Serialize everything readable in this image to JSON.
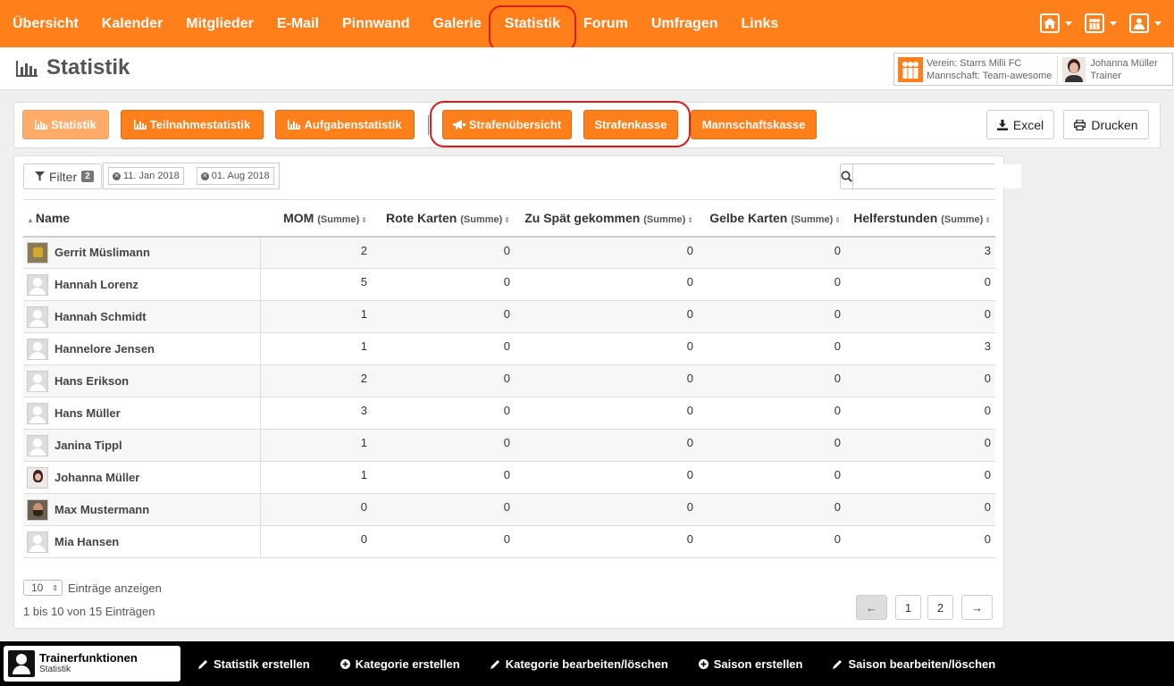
{
  "nav": {
    "items": [
      "Übersicht",
      "Kalender",
      "Mitglieder",
      "E-Mail",
      "Pinnwand",
      "Galerie",
      "Statistik",
      "Forum",
      "Umfragen",
      "Links"
    ],
    "active": "Statistik",
    "right_icons": [
      "home-icon",
      "team-icon",
      "user-icon"
    ]
  },
  "header": {
    "title": "Statistik",
    "club": "Verein: Starrs Milli FC",
    "team": "Mannschaft: Team-awesome",
    "user_name": "Johanna Müller",
    "user_role": "Trainer"
  },
  "toolbar": {
    "statistik": "Statistik",
    "teilnahme": "Teilnahmestatistik",
    "aufgaben": "Aufgabenstatistik",
    "strafenuebersicht": "Strafenübersicht",
    "strafenkasse": "Strafenkasse",
    "mannschaftskasse": "Mannschaftskasse",
    "excel": "Excel",
    "drucken": "Drucken"
  },
  "filter": {
    "label": "Filter",
    "count": "2",
    "date_from": "11. Jan 2018",
    "date_to": "01. Aug 2018",
    "search_placeholder": ""
  },
  "table": {
    "headers": {
      "name": "Name",
      "mom": "MOM",
      "rote": "Rote Karten",
      "spaet": "Zu Spät gekommen",
      "gelbe": "Gelbe Karten",
      "helfer": "Helferstunden",
      "summe": "(Summe)"
    },
    "rows": [
      {
        "name": "Gerrit Müslimann",
        "mom": "2",
        "rote": "0",
        "spaet": "0",
        "gelbe": "0",
        "helfer": "3"
      },
      {
        "name": "Hannah Lorenz",
        "mom": "5",
        "rote": "0",
        "spaet": "0",
        "gelbe": "0",
        "helfer": "0"
      },
      {
        "name": "Hannah Schmidt",
        "mom": "1",
        "rote": "0",
        "spaet": "0",
        "gelbe": "0",
        "helfer": "0"
      },
      {
        "name": "Hannelore Jensen",
        "mom": "1",
        "rote": "0",
        "spaet": "0",
        "gelbe": "0",
        "helfer": "3"
      },
      {
        "name": "Hans Erikson",
        "mom": "2",
        "rote": "0",
        "spaet": "0",
        "gelbe": "0",
        "helfer": "0"
      },
      {
        "name": "Hans Müller",
        "mom": "3",
        "rote": "0",
        "spaet": "0",
        "gelbe": "0",
        "helfer": "0"
      },
      {
        "name": "Janina Tippl",
        "mom": "1",
        "rote": "0",
        "spaet": "0",
        "gelbe": "0",
        "helfer": "0"
      },
      {
        "name": "Johanna Müller",
        "mom": "1",
        "rote": "0",
        "spaet": "0",
        "gelbe": "0",
        "helfer": "0"
      },
      {
        "name": "Max Mustermann",
        "mom": "0",
        "rote": "0",
        "spaet": "0",
        "gelbe": "0",
        "helfer": "0"
      },
      {
        "name": "Mia Hansen",
        "mom": "0",
        "rote": "0",
        "spaet": "0",
        "gelbe": "0",
        "helfer": "0"
      }
    ]
  },
  "footer": {
    "page_length": "10",
    "length_label": "Einträge anzeigen",
    "info": "1 bis 10 von 15 Einträgen",
    "prev": "←",
    "pages": [
      "1",
      "2"
    ],
    "next": "→"
  },
  "bottombar": {
    "trainer_title": "Trainerfunktionen",
    "trainer_sub": "Statistik",
    "items": [
      "Statistik erstellen",
      "Kategorie erstellen",
      "Kategorie bearbeiten/löschen",
      "Saison erstellen",
      "Saison bearbeiten/löschen"
    ]
  },
  "colors": {
    "accent": "#ff7f1a",
    "highlight_ring": "#e01b1b"
  }
}
